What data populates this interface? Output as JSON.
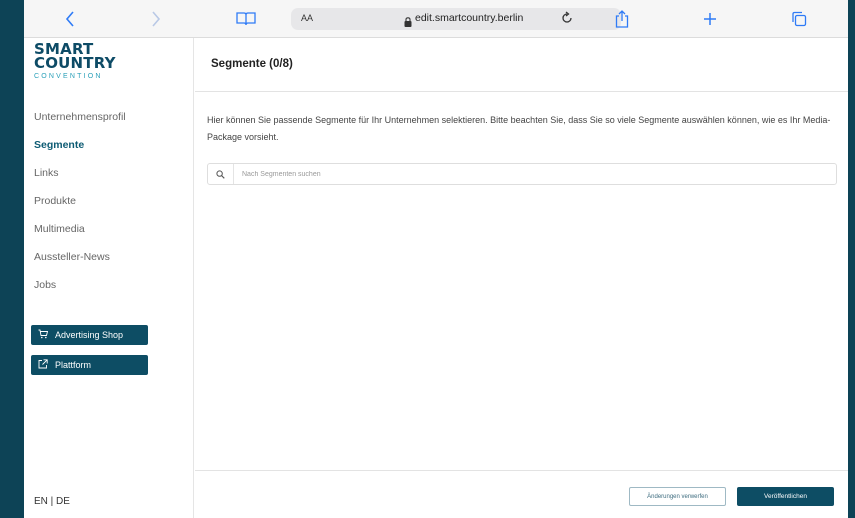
{
  "browser": {
    "font_size_label": "AA",
    "url": "edit.smartcountry.berlin",
    "icons": [
      "chevron-left-icon",
      "chevron-right-icon",
      "book-icon",
      "lock-icon",
      "reload-icon",
      "share-icon",
      "plus-icon",
      "tabs-icon"
    ],
    "accent_color": "#2f7bf6"
  },
  "logo": {
    "line1": "SMART",
    "line2": "COUNTRY",
    "line3": "CONVENTION"
  },
  "sidebar": {
    "items": [
      {
        "label": "Unternehmensprofil",
        "active": false
      },
      {
        "label": "Segmente",
        "active": true
      },
      {
        "label": "Links",
        "active": false
      },
      {
        "label": "Produkte",
        "active": false
      },
      {
        "label": "Multimedia",
        "active": false
      },
      {
        "label": "Aussteller-News",
        "active": false
      },
      {
        "label": "Jobs",
        "active": false
      }
    ],
    "advertising_label": "Advertising Shop",
    "platform_label": "Plattform",
    "lang_label": "EN | DE"
  },
  "main": {
    "title": "Segmente (0/8)",
    "description": "Hier können Sie passende Segmente für Ihr Unternehmen selektieren. Bitte beachten Sie, dass Sie so viele Segmente auswählen können, wie es Ihr Media-Package vorsieht.",
    "search_placeholder": "Nach Segmenten suchen",
    "search_value": ""
  },
  "footer": {
    "discard_label": "Änderungen verwerfen",
    "publish_label": "Veröffentlichen"
  },
  "colors": {
    "brand": "#0d4d64",
    "active_nav": "#0d5b73",
    "logo_sub": "#2aa0b9"
  }
}
